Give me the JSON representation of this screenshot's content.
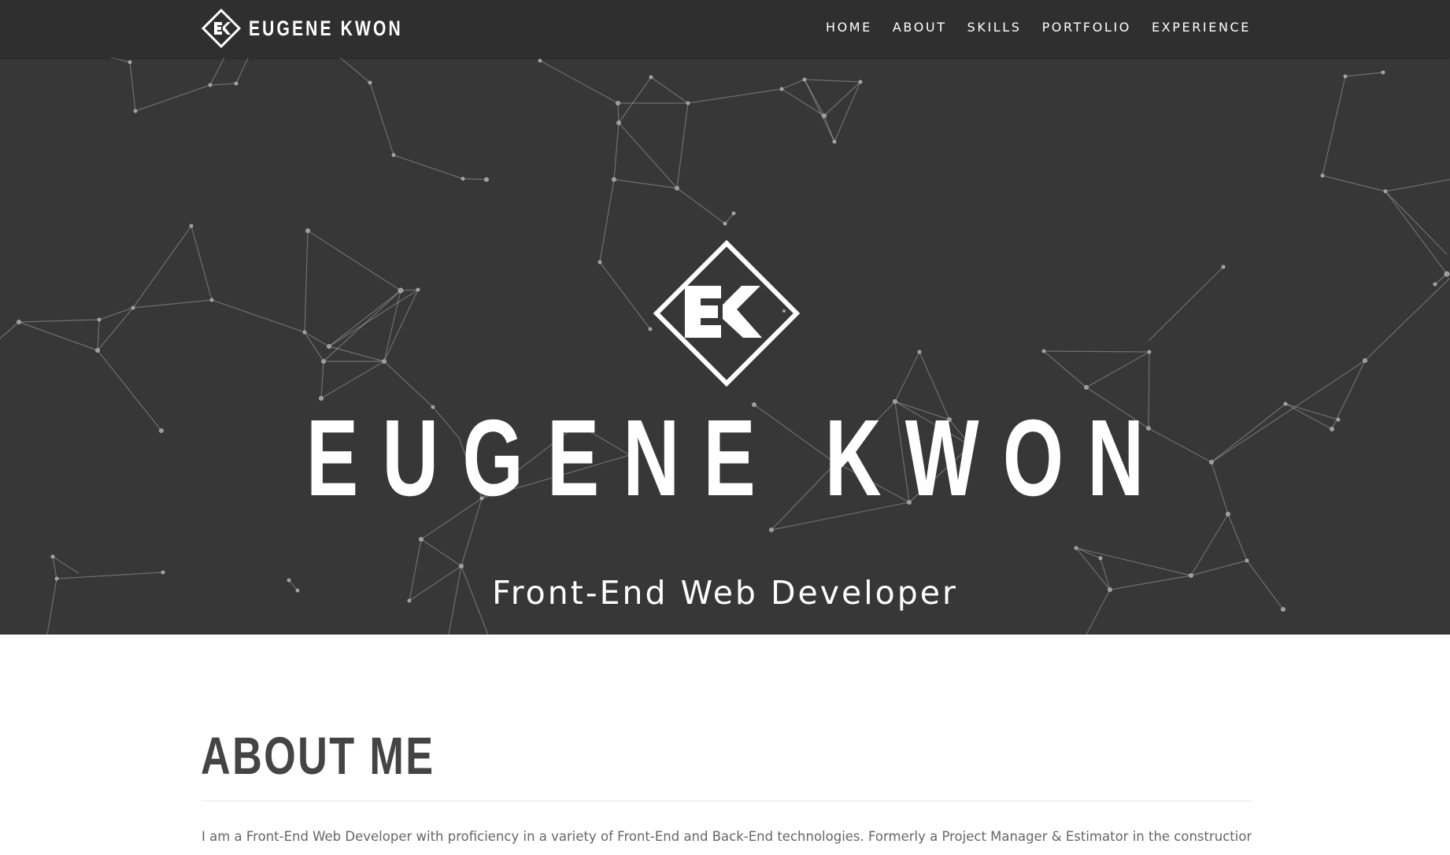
{
  "navbar": {
    "brand": {
      "logo_icon": "ek-diamond-logo-icon",
      "name": "EUGENE KWON"
    },
    "links": [
      "HOME",
      "ABOUT",
      "SKILLS",
      "PORTFOLIO",
      "EXPERIENCE"
    ]
  },
  "hero": {
    "logo_icon": "ek-diamond-logo-icon",
    "title": "EUGENE KWON",
    "subtitle": "Front-End Web Developer",
    "background": "particle-network"
  },
  "about": {
    "title": "ABOUT ME",
    "paragraph": "I am a Front-End Web Developer with proficiency in a variety of Front-End and Back-End technologies. Formerly a Project Manager & Estimator in the construction industry by trade but"
  },
  "colors": {
    "navbar_bg": "#2f2f2f",
    "hero_bg": "#373737",
    "accent": "#ffffff",
    "heading_text": "#444444",
    "body_text": "#666666"
  }
}
